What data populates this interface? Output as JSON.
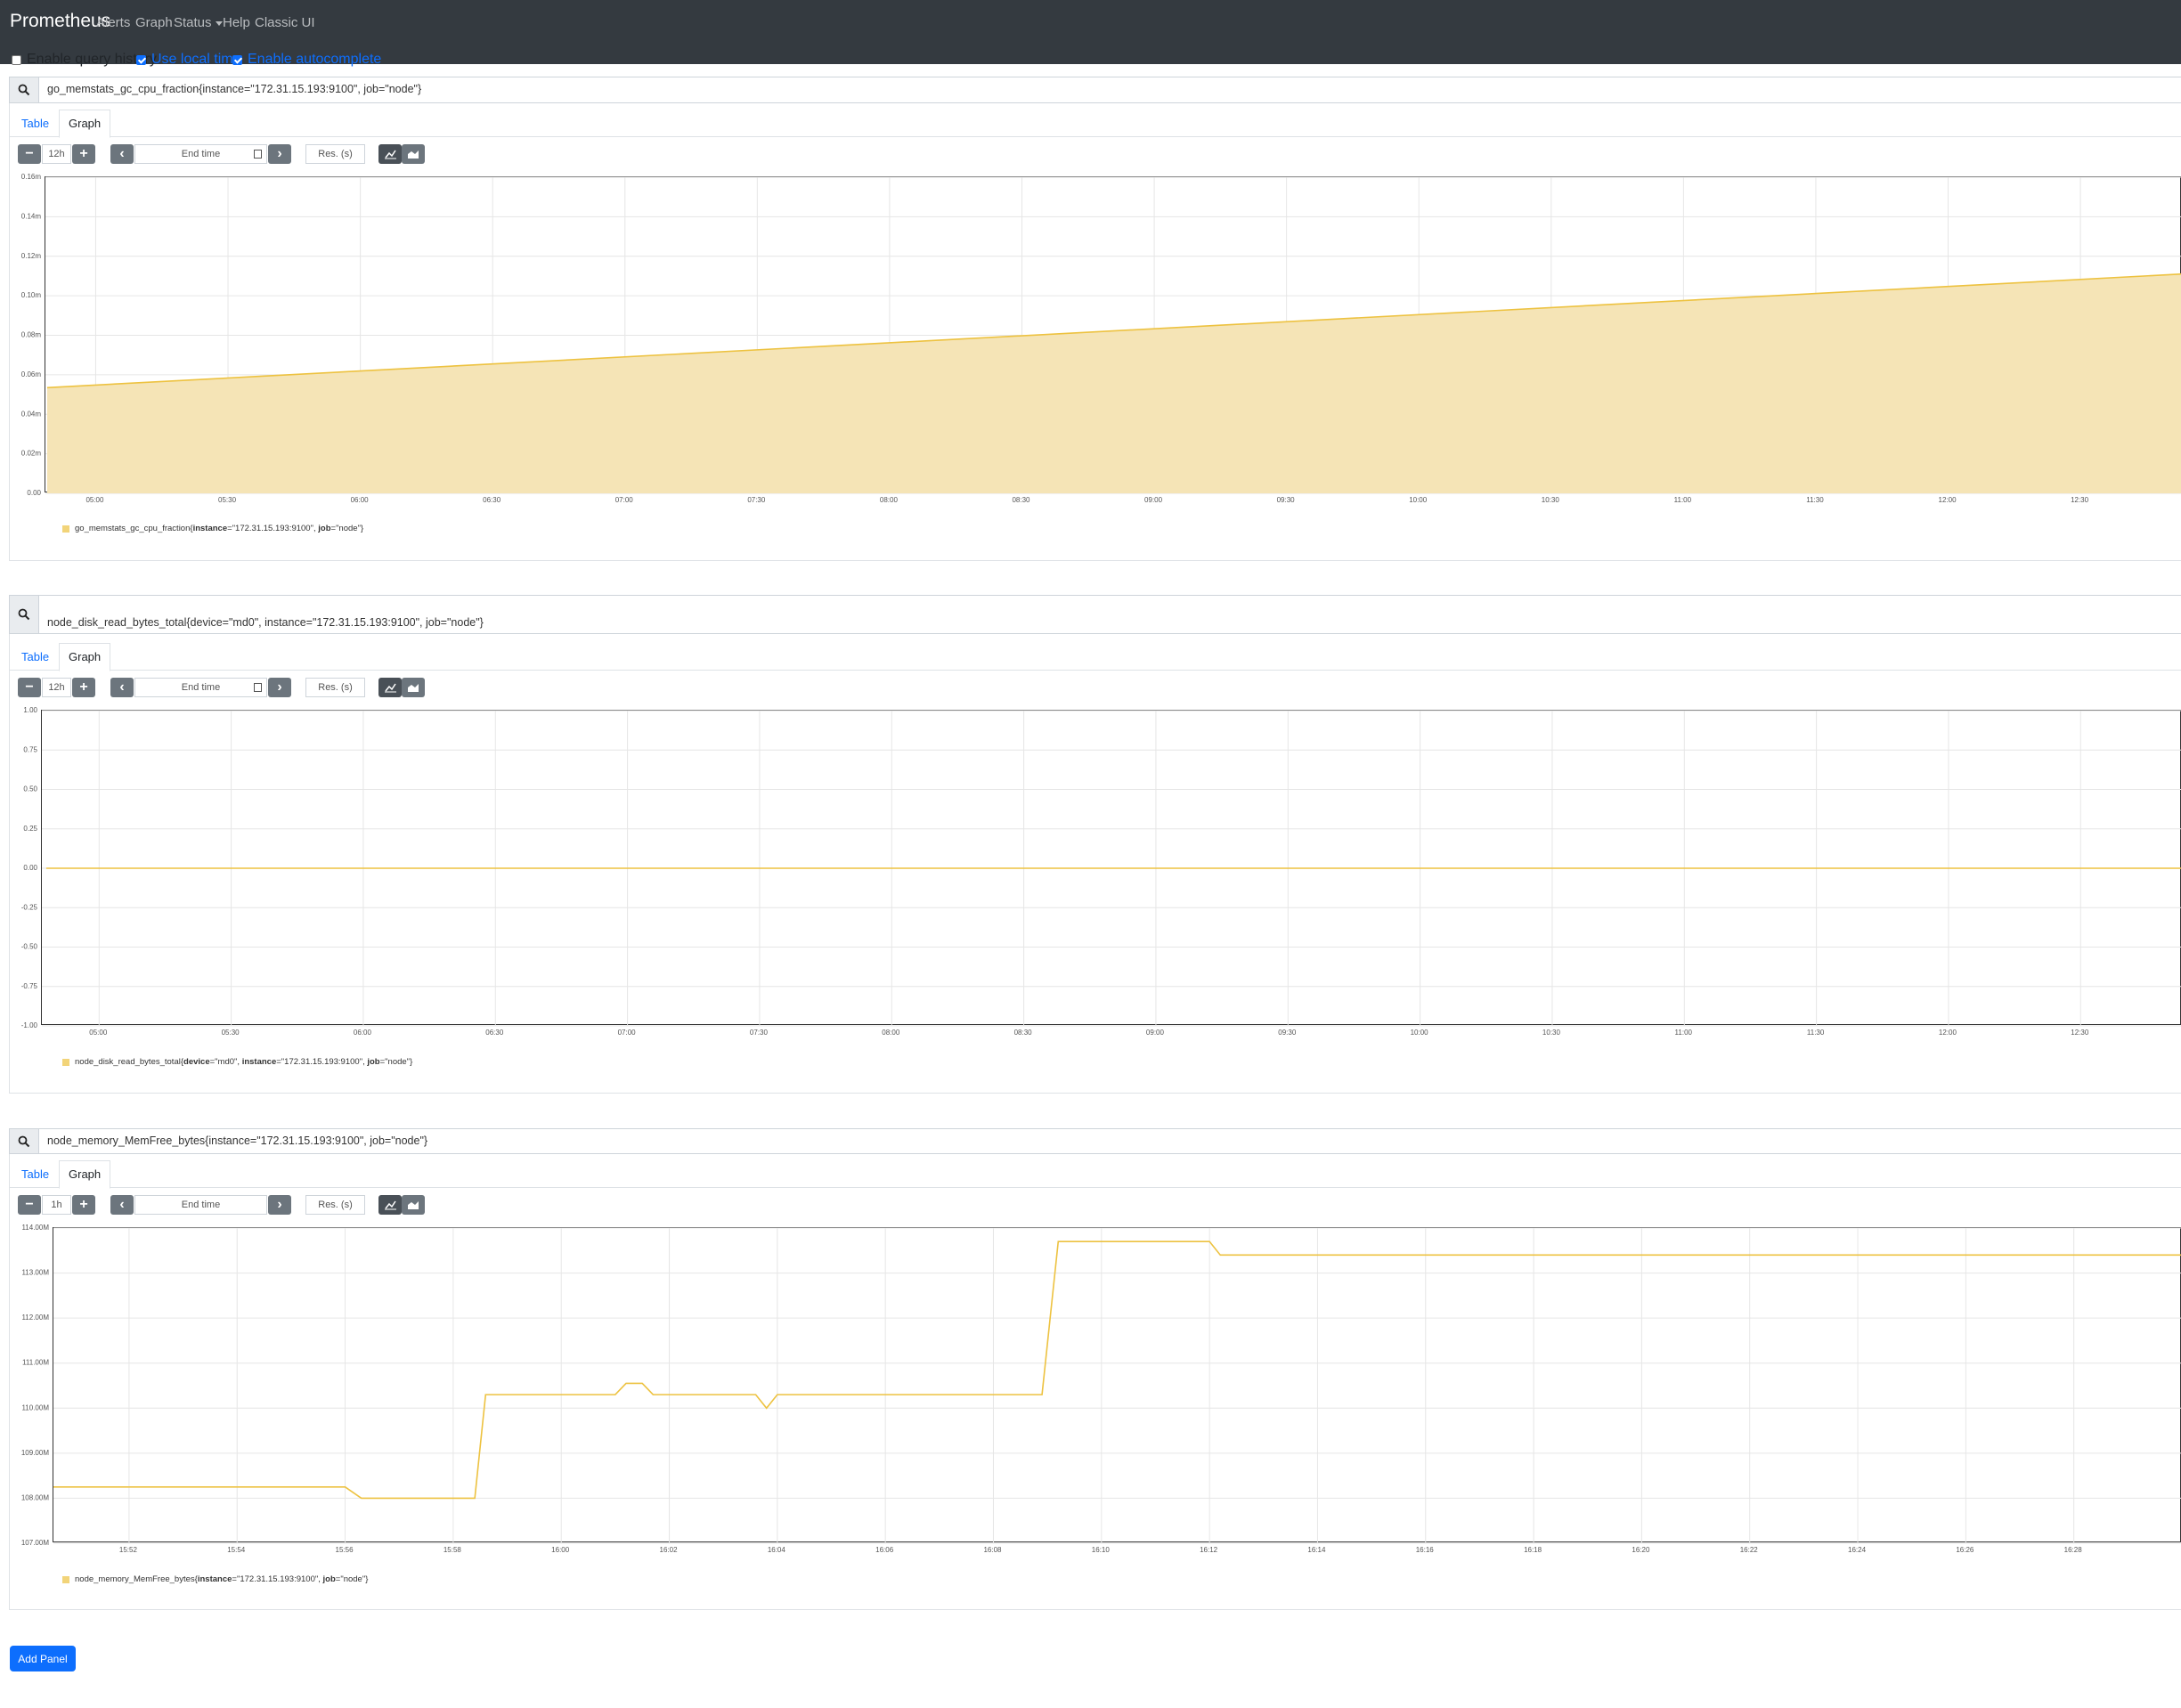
{
  "nav": {
    "brand": "Prometheus",
    "alerts": "Alerts",
    "graph": "Graph",
    "status": "Status",
    "help": "Help",
    "classic": "Classic UI"
  },
  "options": {
    "query_history": {
      "label": "Enable query history",
      "checked": false
    },
    "local_time": {
      "label": "Use local time",
      "checked": true
    },
    "autocomplete": {
      "label": "Enable autocomplete",
      "checked": true
    }
  },
  "panels": [
    {
      "query": "go_memstats_gc_cpu_fraction{instance=\"172.31.15.193:9100\", job=\"node\"}",
      "tab_table": "Table",
      "tab_graph": "Graph",
      "range": "12h",
      "end_time_placeholder": "End time",
      "res_placeholder": "Res. (s)",
      "legend_metric": "go_memstats_gc_cpu_fraction",
      "legend_labels": [
        [
          "instance",
          "\"172.31.15.193:9100\""
        ],
        [
          "job",
          "\"node\""
        ]
      ]
    },
    {
      "query": "node_disk_read_bytes_total{device=\"md0\", instance=\"172.31.15.193:9100\", job=\"node\"}",
      "tab_table": "Table",
      "tab_graph": "Graph",
      "range": "12h",
      "end_time_placeholder": "End time",
      "res_placeholder": "Res. (s)",
      "legend_metric": "node_disk_read_bytes_total",
      "legend_labels": [
        [
          "device",
          "\"md0\""
        ],
        [
          "instance",
          "\"172.31.15.193:9100\""
        ],
        [
          "job",
          "\"node\""
        ]
      ]
    },
    {
      "query": "node_memory_MemFree_bytes{instance=\"172.31.15.193:9100\", job=\"node\"}",
      "tab_table": "Table",
      "tab_graph": "Graph",
      "range": "1h",
      "end_time_placeholder": "End time",
      "res_placeholder": "Res. (s)",
      "legend_metric": "node_memory_MemFree_bytes",
      "legend_labels": [
        [
          "instance",
          "\"172.31.15.193:9100\""
        ],
        [
          "job",
          "\"node\""
        ]
      ]
    }
  ],
  "add_panel": "Add Panel",
  "colors": {
    "series": "#edc240",
    "fill": "#f5e4b6",
    "accent": "#0d6efd",
    "navbar": "#343a40"
  },
  "chart_data": [
    {
      "type": "area",
      "x_ticks": [
        "05:00",
        "05:30",
        "06:00",
        "06:30",
        "07:00",
        "07:30",
        "08:00",
        "08:30",
        "09:00",
        "09:30",
        "10:00",
        "10:30",
        "11:00",
        "11:30",
        "12:00",
        "12:30"
      ],
      "y_ticks": [
        "0.00",
        "0.02m",
        "0.04m",
        "0.06m",
        "0.08m",
        "0.10m",
        "0.12m",
        "0.14m",
        "0.16m"
      ],
      "ylim": [
        0,
        0.16
      ],
      "series": [
        {
          "name": "go_memstats_gc_cpu_fraction{instance=\"172.31.15.193:9100\", job=\"node\"}",
          "x": [
            "04:49",
            "12:53"
          ],
          "values": [
            0.0535,
            0.111
          ]
        }
      ]
    },
    {
      "type": "line",
      "x_ticks": [
        "05:00",
        "05:30",
        "06:00",
        "06:30",
        "07:00",
        "07:30",
        "08:00",
        "08:30",
        "09:00",
        "09:30",
        "10:00",
        "10:30",
        "11:00",
        "11:30",
        "12:00",
        "12:30"
      ],
      "y_ticks": [
        "-1.00",
        "-0.75",
        "-0.50",
        "-0.25",
        "0.00",
        "0.25",
        "0.50",
        "0.75",
        "1.00"
      ],
      "ylim": [
        -1,
        1
      ],
      "series": [
        {
          "name": "node_disk_read_bytes_total{device=\"md0\", instance=\"172.31.15.193:9100\", job=\"node\"}",
          "x": [
            "04:48",
            "12:53"
          ],
          "values": [
            0,
            0
          ]
        }
      ]
    },
    {
      "type": "line",
      "x_ticks": [
        "15:52",
        "15:54",
        "15:56",
        "15:58",
        "16:00",
        "16:02",
        "16:04",
        "16:06",
        "16:08",
        "16:10",
        "16:12",
        "16:14",
        "16:16",
        "16:18",
        "16:20",
        "16:22",
        "16:24",
        "16:26",
        "16:28"
      ],
      "y_ticks": [
        "107.00M",
        "108.00M",
        "109.00M",
        "110.00M",
        "111.00M",
        "112.00M",
        "113.00M",
        "114.00M"
      ],
      "ylim": [
        107,
        114
      ],
      "series": [
        {
          "name": "node_memory_MemFree_bytes{instance=\"172.31.15.193:9100\", job=\"node\"}",
          "x": [
            "15:50.6",
            "15:56.0",
            "15:56.3",
            "15:58.4",
            "15:58.6",
            "16:01.0",
            "16:01.2",
            "16:01.5",
            "16:01.7",
            "16:03.6",
            "16:03.8",
            "16:04.0",
            "16:08.9",
            "16:09.2",
            "16:12.0",
            "16:12.2",
            "16:30.0"
          ],
          "values": [
            108.25,
            108.25,
            108.0,
            108.0,
            110.3,
            110.3,
            110.55,
            110.55,
            110.3,
            110.3,
            110.0,
            110.3,
            110.3,
            113.7,
            113.7,
            113.4,
            113.4
          ]
        }
      ]
    }
  ]
}
